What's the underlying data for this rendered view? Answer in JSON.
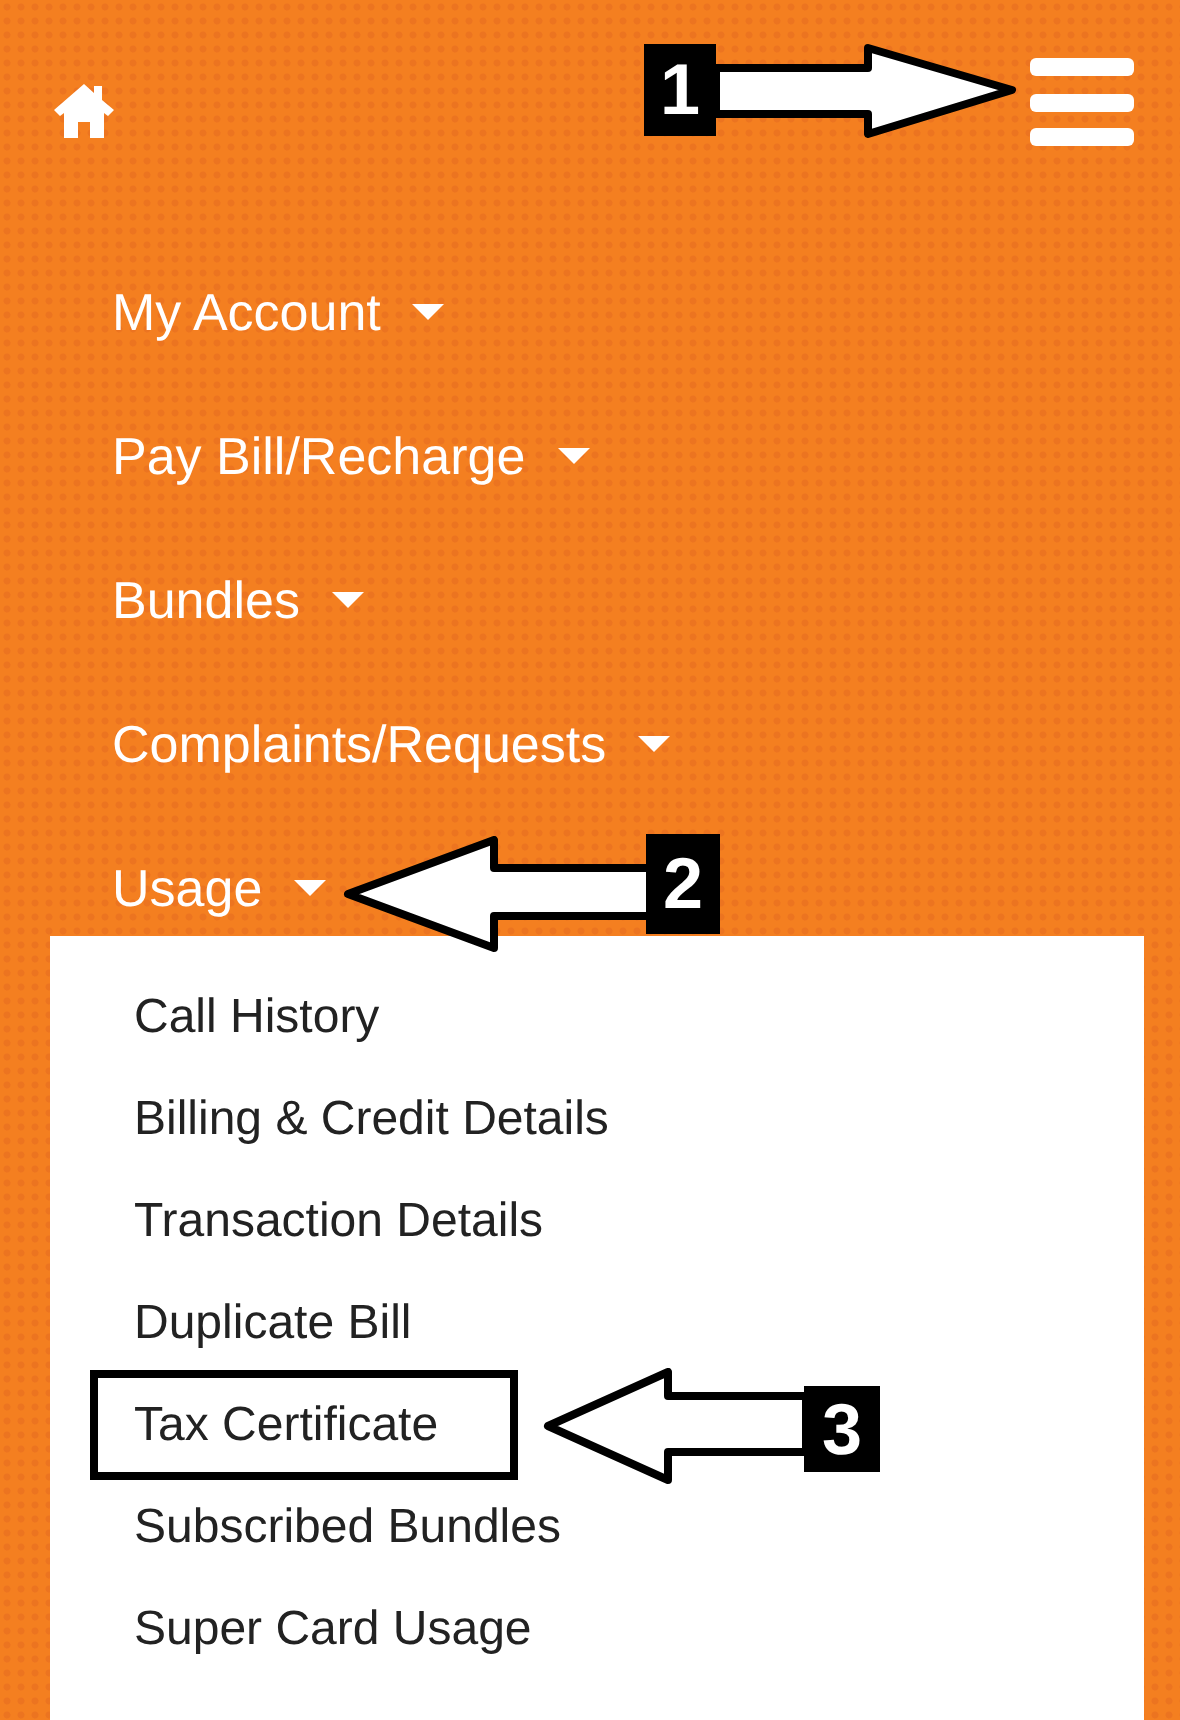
{
  "menu": [
    {
      "label": "My Account"
    },
    {
      "label": "Pay Bill/Recharge"
    },
    {
      "label": "Bundles"
    },
    {
      "label": "Complaints/Requests"
    },
    {
      "label": "Usage",
      "children": [
        {
          "label": "Call History",
          "highlighted": false
        },
        {
          "label": "Billing & Credit Details",
          "highlighted": false
        },
        {
          "label": "Transaction Details",
          "highlighted": false
        },
        {
          "label": "Duplicate Bill",
          "highlighted": false
        },
        {
          "label": "Tax Certificate",
          "highlighted": true
        },
        {
          "label": "Subscribed Bundles",
          "highlighted": false
        },
        {
          "label": "Super Card Usage",
          "highlighted": false
        }
      ]
    }
  ],
  "annotations": [
    {
      "label": "1"
    },
    {
      "label": "2"
    },
    {
      "label": "3"
    }
  ]
}
